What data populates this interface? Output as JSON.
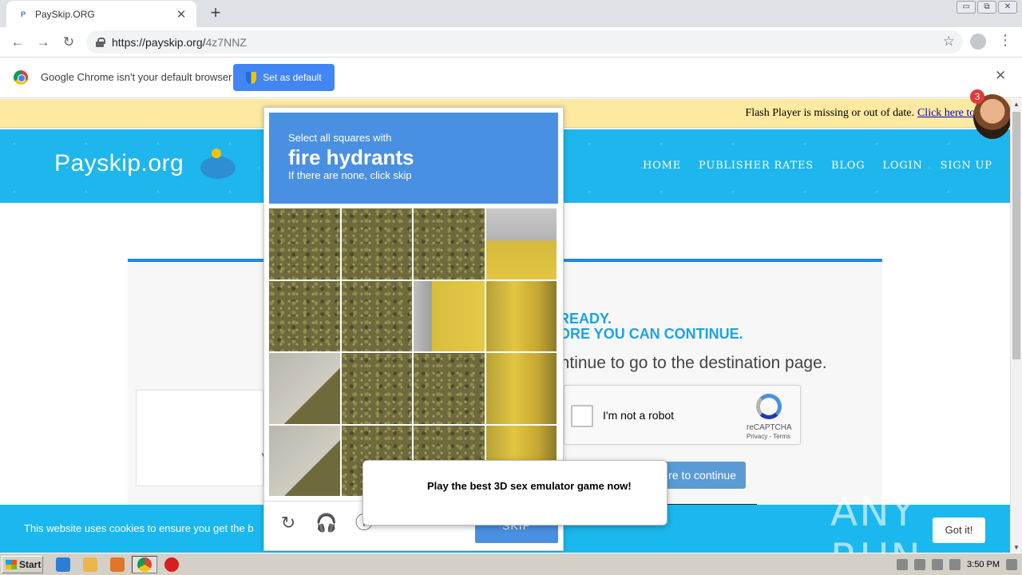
{
  "browser": {
    "tab_title": "PaySkip.ORG",
    "tab_favicon": "P",
    "url_main": "https://payskip.org/",
    "url_path": "4z7NNZ",
    "infobar_message": "Google Chrome isn't your default browser",
    "infobar_button": "Set as default",
    "new_tab": "+",
    "close": "✕",
    "minimize": "▭",
    "maximize": "⧉"
  },
  "page": {
    "flash_message": "Flash Player is missing or out of date.",
    "flash_link": "Click here to install",
    "brand": "Payskip.org",
    "nav": [
      "HOME",
      "PUBLISHER RATES",
      "BLOG",
      "LOGIN",
      "SIGN UP"
    ],
    "badge_count": "3",
    "heading_line1": "READY.",
    "heading_line2": "ORE YOU CAN CONTINUE.",
    "lead": "ontinue to go to the destination page.",
    "ad_letter": "V",
    "recaptcha_label": "I'm not a robot",
    "recaptcha_name": "reCAPTCHA",
    "recaptcha_links": "Privacy - Terms",
    "continue_button": "re to continue",
    "cookie_message": "This website uses cookies to ensure you get the b",
    "cookie_button": "Got it!",
    "watermark": "ANY RUN"
  },
  "challenge": {
    "line1": "Select all squares with",
    "target": "fire hydrants",
    "line3": "If there are none, click skip",
    "skip_button": "SKIP",
    "icons": [
      "reload-icon",
      "headphones-icon",
      "info-icon"
    ]
  },
  "ad_popup": {
    "text": "Play the best 3D sex emulator game now!"
  },
  "taskbar": {
    "start": "Start",
    "clock": "3:50 PM"
  },
  "colors": {
    "header_blue": "#1eb6ec",
    "captcha_blue": "#4a90e2",
    "flash_yellow": "#fde9a0"
  }
}
